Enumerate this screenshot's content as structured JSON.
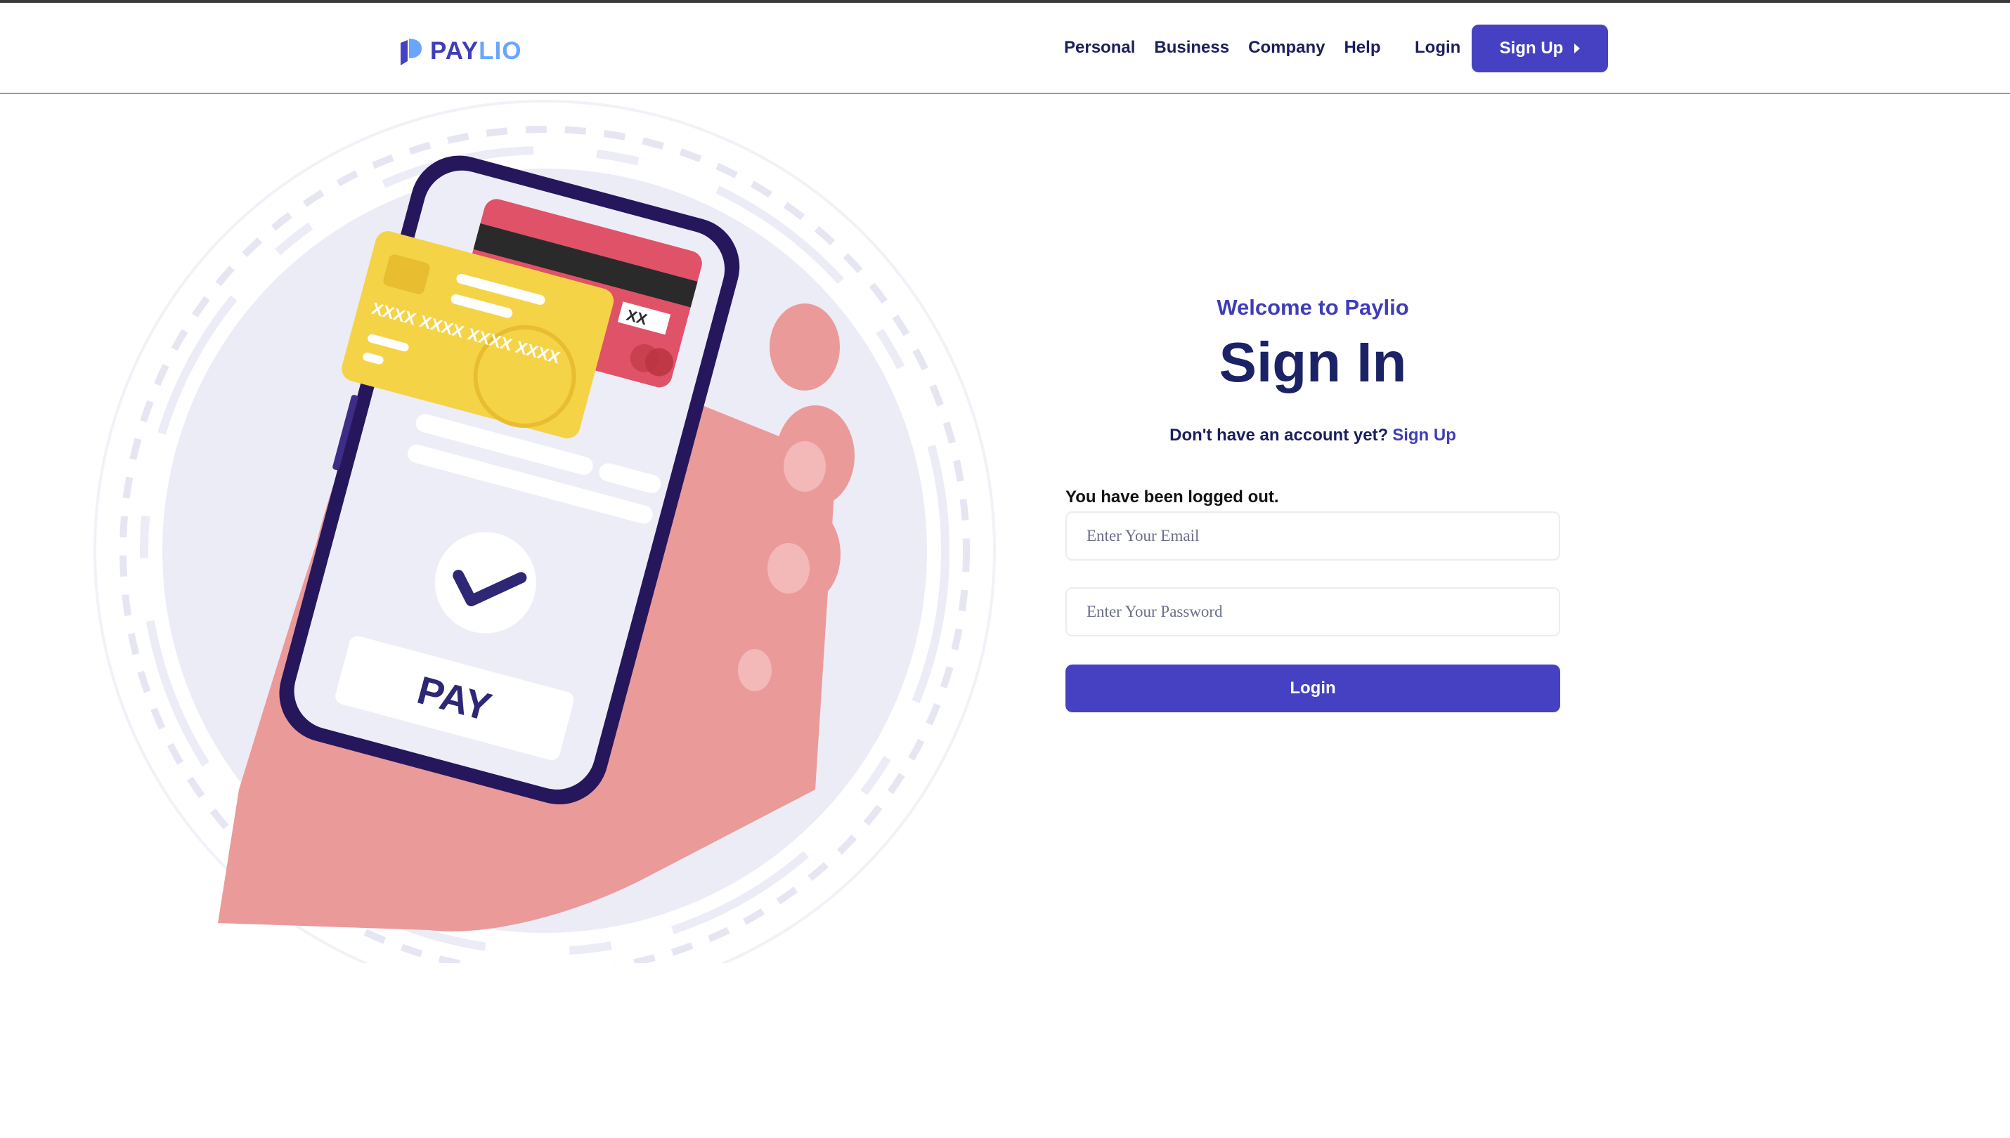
{
  "brand": {
    "name_part1": "PAY",
    "name_part2": "LIO",
    "primary_color": "#4641c3",
    "accent_color": "#6aa6ff",
    "dark_text_color": "#1b1f5c"
  },
  "nav": {
    "items": [
      {
        "label": "Personal"
      },
      {
        "label": "Business"
      },
      {
        "label": "Company"
      },
      {
        "label": "Help"
      }
    ],
    "login_label": "Login",
    "signup_label": "Sign Up"
  },
  "illustration": {
    "card_number": "XXXX XXXX XXXX XXXX",
    "card_back_text": "XX",
    "pay_label": "PAY",
    "icons": [
      "credit-card-icon",
      "checkmark-icon",
      "phone-icon",
      "hand-icon"
    ]
  },
  "signin": {
    "welcome": "Welcome to Paylio",
    "title": "Sign In",
    "no_account_text": "Don't have an account yet?",
    "signup_link": "Sign Up",
    "status_message": "You have been logged out.",
    "email_placeholder": "Enter Your Email",
    "password_placeholder": "Enter Your Password",
    "login_button": "Login"
  }
}
